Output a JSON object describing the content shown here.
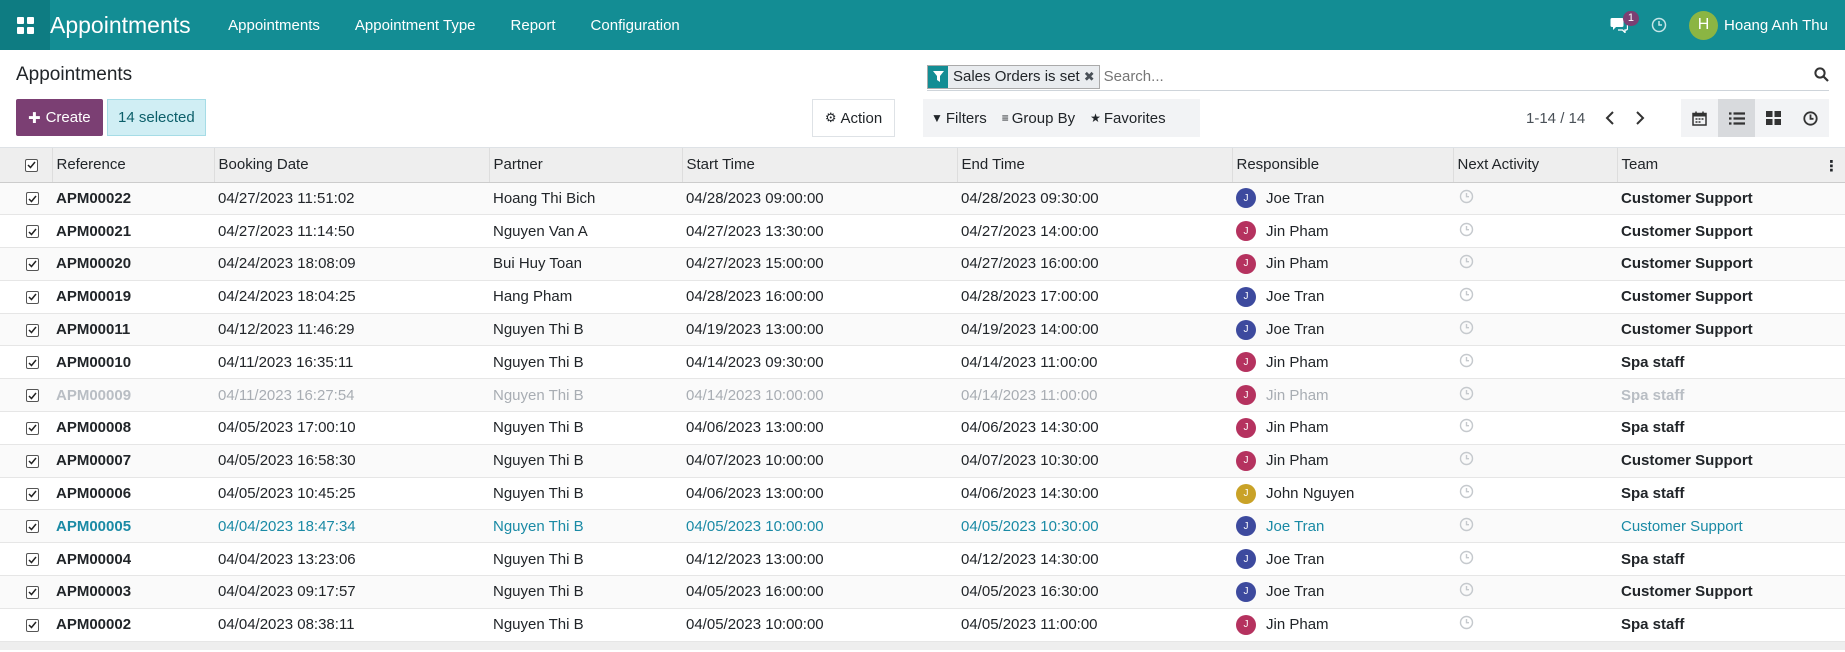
{
  "topbar": {
    "app_title": "Appointments",
    "menu": [
      "Appointments",
      "Appointment Type",
      "Report",
      "Configuration"
    ],
    "chat_count": "1",
    "user_initial": "H",
    "user_name": "Hoang Anh Thu"
  },
  "control": {
    "page_title": "Appointments",
    "create_label": "Create",
    "selected_label": "14 selected",
    "action_label": "Action",
    "facet_label": "Sales Orders is set",
    "search_placeholder": "Search...",
    "filters_label": "Filters",
    "groupby_label": "Group By",
    "favorites_label": "Favorites",
    "pager": "1-14 / 14"
  },
  "table": {
    "columns": [
      "Reference",
      "Booking Date",
      "Partner",
      "Start Time",
      "End Time",
      "Responsible",
      "Next Activity",
      "Team"
    ],
    "rows": [
      {
        "ref": "APM00022",
        "booking": "04/27/2023 11:51:02",
        "partner": "Hoang Thi Bich",
        "start": "04/28/2023 09:00:00",
        "end": "04/28/2023 09:30:00",
        "resp": "Joe Tran",
        "initial": "J",
        "color": "#3d4a9e",
        "team": "Customer Support",
        "state": "normal"
      },
      {
        "ref": "APM00021",
        "booking": "04/27/2023 11:14:50",
        "partner": "Nguyen Van A",
        "start": "04/27/2023 13:30:00",
        "end": "04/27/2023 14:00:00",
        "resp": "Jin Pham",
        "initial": "J",
        "color": "#b5325f",
        "team": "Customer Support",
        "state": "normal"
      },
      {
        "ref": "APM00020",
        "booking": "04/24/2023 18:08:09",
        "partner": "Bui Huy Toan",
        "start": "04/27/2023 15:00:00",
        "end": "04/27/2023 16:00:00",
        "resp": "Jin Pham",
        "initial": "J",
        "color": "#b5325f",
        "team": "Customer Support",
        "state": "normal"
      },
      {
        "ref": "APM00019",
        "booking": "04/24/2023 18:04:25",
        "partner": "Hang Pham",
        "start": "04/28/2023 16:00:00",
        "end": "04/28/2023 17:00:00",
        "resp": "Joe Tran",
        "initial": "J",
        "color": "#3d4a9e",
        "team": "Customer Support",
        "state": "normal"
      },
      {
        "ref": "APM00011",
        "booking": "04/12/2023 11:46:29",
        "partner": "Nguyen Thi B",
        "start": "04/19/2023 13:00:00",
        "end": "04/19/2023 14:00:00",
        "resp": "Joe Tran",
        "initial": "J",
        "color": "#3d4a9e",
        "team": "Customer Support",
        "state": "normal"
      },
      {
        "ref": "APM00010",
        "booking": "04/11/2023 16:35:11",
        "partner": "Nguyen Thi B",
        "start": "04/14/2023 09:30:00",
        "end": "04/14/2023 11:00:00",
        "resp": "Jin Pham",
        "initial": "J",
        "color": "#b5325f",
        "team": "Spa staff",
        "state": "normal"
      },
      {
        "ref": "APM00009",
        "booking": "04/11/2023 16:27:54",
        "partner": "Nguyen Thi B",
        "start": "04/14/2023 10:00:00",
        "end": "04/14/2023 11:00:00",
        "resp": "Jin Pham",
        "initial": "J",
        "color": "#b5325f",
        "team": "Spa staff",
        "state": "muted"
      },
      {
        "ref": "APM00008",
        "booking": "04/05/2023 17:00:10",
        "partner": "Nguyen Thi B",
        "start": "04/06/2023 13:00:00",
        "end": "04/06/2023 14:30:00",
        "resp": "Jin Pham",
        "initial": "J",
        "color": "#b5325f",
        "team": "Spa staff",
        "state": "normal"
      },
      {
        "ref": "APM00007",
        "booking": "04/05/2023 16:58:30",
        "partner": "Nguyen Thi B",
        "start": "04/07/2023 10:00:00",
        "end": "04/07/2023 10:30:00",
        "resp": "Jin Pham",
        "initial": "J",
        "color": "#b5325f",
        "team": "Customer Support",
        "state": "normal"
      },
      {
        "ref": "APM00006",
        "booking": "04/05/2023 10:45:25",
        "partner": "Nguyen Thi B",
        "start": "04/06/2023 13:00:00",
        "end": "04/06/2023 14:30:00",
        "resp": "John Nguyen",
        "initial": "J",
        "color": "#c9a227",
        "team": "Spa staff",
        "state": "normal"
      },
      {
        "ref": "APM00005",
        "booking": "04/04/2023 18:47:34",
        "partner": "Nguyen Thi B",
        "start": "04/05/2023 10:00:00",
        "end": "04/05/2023 10:30:00",
        "resp": "Joe Tran",
        "initial": "J",
        "color": "#3d4a9e",
        "team": "Customer Support",
        "state": "info"
      },
      {
        "ref": "APM00004",
        "booking": "04/04/2023 13:23:06",
        "partner": "Nguyen Thi B",
        "start": "04/12/2023 13:00:00",
        "end": "04/12/2023 14:30:00",
        "resp": "Joe Tran",
        "initial": "J",
        "color": "#3d4a9e",
        "team": "Spa staff",
        "state": "normal"
      },
      {
        "ref": "APM00003",
        "booking": "04/04/2023 09:17:57",
        "partner": "Nguyen Thi B",
        "start": "04/05/2023 16:00:00",
        "end": "04/05/2023 16:30:00",
        "resp": "Joe Tran",
        "initial": "J",
        "color": "#3d4a9e",
        "team": "Customer Support",
        "state": "normal"
      },
      {
        "ref": "APM00002",
        "booking": "04/04/2023 08:38:11",
        "partner": "Nguyen Thi B",
        "start": "04/05/2023 10:00:00",
        "end": "04/05/2023 11:00:00",
        "resp": "Jin Pham",
        "initial": "J",
        "color": "#b5325f",
        "team": "Spa staff",
        "state": "normal"
      }
    ]
  }
}
